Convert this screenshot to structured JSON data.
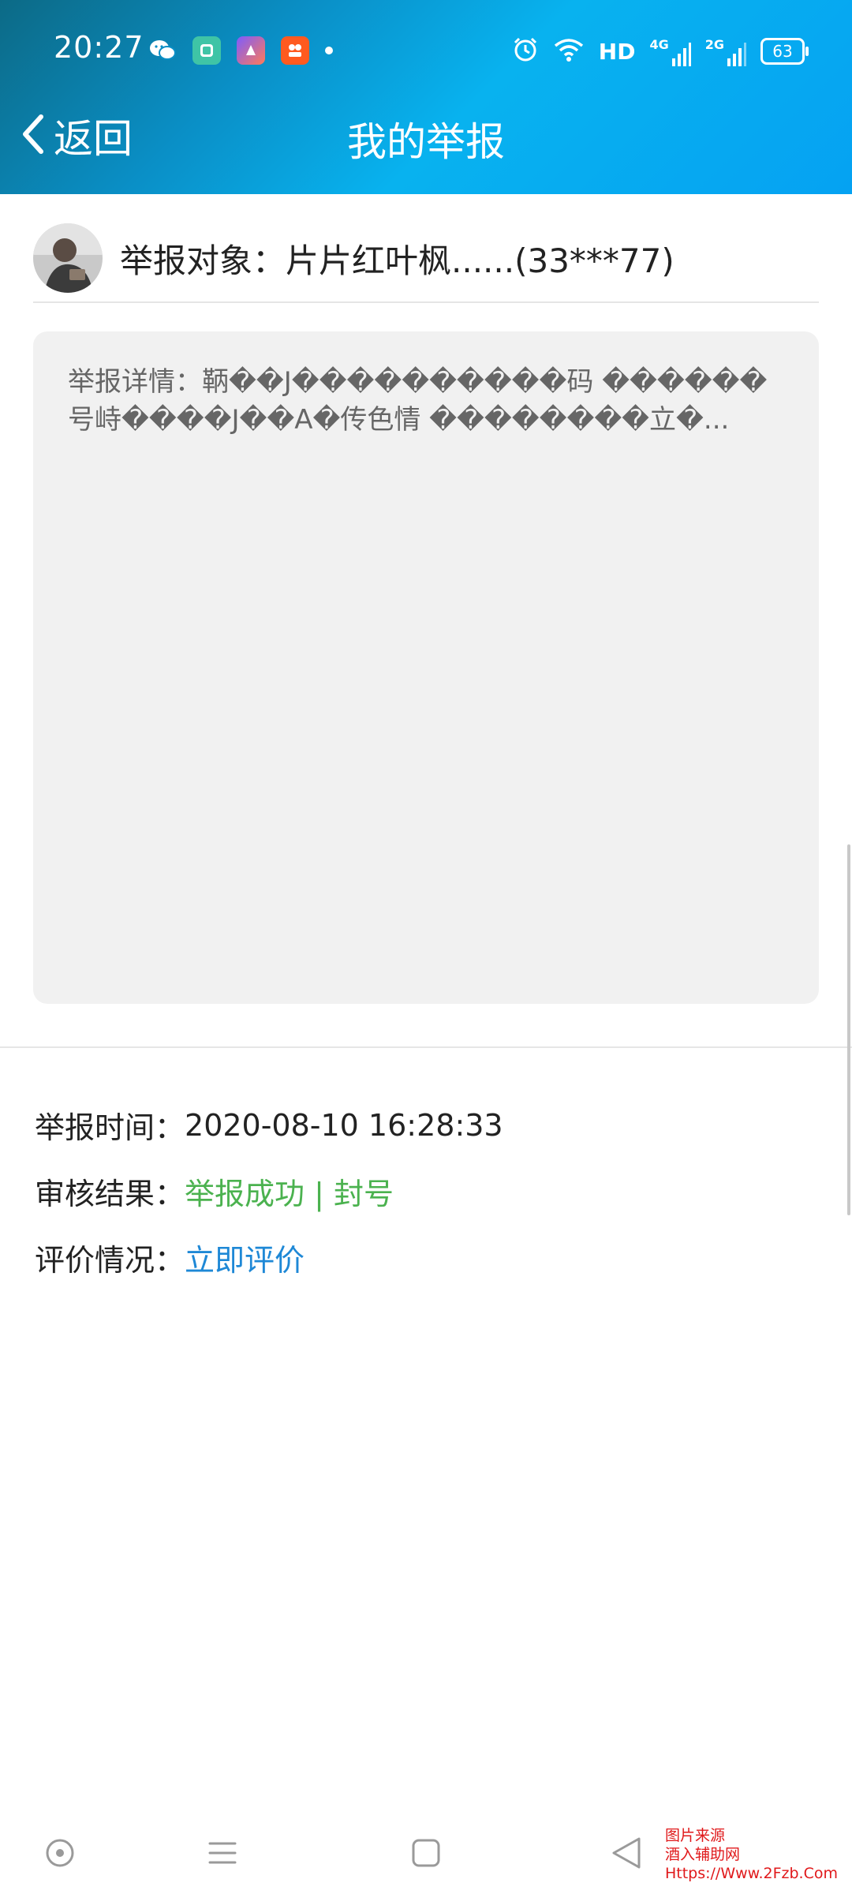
{
  "status_bar": {
    "time": "20:27",
    "hd_label": "HD",
    "net_4g": "4G",
    "net_2g": "2G",
    "battery": "63",
    "icons": [
      "wechat-icon",
      "green-app-icon",
      "purple-app-icon",
      "orange-app-icon",
      "notification-dot",
      "alarm-icon",
      "wifi-icon",
      "signal-4g-icon",
      "signal-2g-icon",
      "battery-icon"
    ]
  },
  "header": {
    "back_label": "返回",
    "title": "我的举报",
    "gradient_colors": [
      "#0c6a86",
      "#08b2ef",
      "#05a2f2"
    ]
  },
  "report": {
    "target": "举报对象：片片红叶枫......(33***77)",
    "details": "举报详情：鞆��J����������码 ������号峙����J��A�传色情 ��������立�..."
  },
  "info": {
    "time_label": "举报时间：",
    "time_value": "2020-08-10 16:28:33",
    "result_label": "审核结果：",
    "result_value": "举报成功 | 封号",
    "eval_label": "评价情况：",
    "eval_link": "立即评价",
    "colors": {
      "result": "#4bb24f",
      "link": "#1e88d6"
    }
  },
  "nav_bar": {
    "icons": [
      "assistant-dot-icon",
      "menu-lines-icon",
      "home-square-icon",
      "back-triangle-icon"
    ]
  },
  "watermark": {
    "line1": "图片来源",
    "line2": "酒入辅助网",
    "line3": "Https://Www.2Fzb.Com"
  }
}
